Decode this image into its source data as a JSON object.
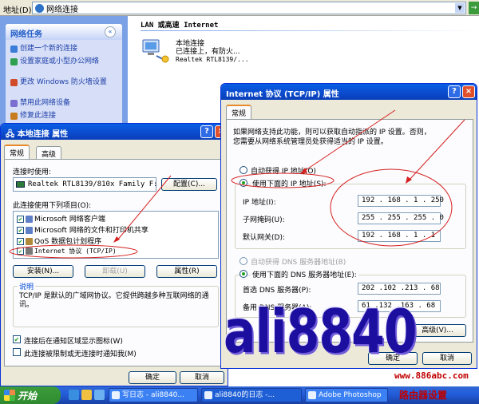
{
  "explorer": {
    "address_label": "地址(D)",
    "address_value": "网络连接",
    "go_label": "→",
    "task_pane": {
      "title": "网络任务",
      "collapse": "«",
      "items": [
        {
          "label": "创建一个新的连接",
          "color": "#3a7cd8"
        },
        {
          "label": "设置家庭或小型办公网络",
          "color": "#2fa04f"
        },
        {
          "label": "更改 Windows 防火墙设置",
          "color": "#d04b2a"
        },
        {
          "label": "禁用此网络设备",
          "color": "#7a6fd0"
        },
        {
          "label": "修复此连接",
          "color": "#c77d1f"
        }
      ]
    },
    "section_title": "LAN 或高速 Internet",
    "connection": {
      "line1": "本地连接",
      "line2": "已连接上，有防火...",
      "line3": "Realtek RTL8139/..."
    }
  },
  "local_dialog": {
    "title": "本地连接 属性",
    "help_btn": "?",
    "close_btn": "×",
    "tabs": [
      "常规",
      "高级"
    ],
    "connect_using_label": "连接时使用:",
    "adapter_name": "Realtek RTL8139/810x Family F:",
    "configure_btn": "配置(C)...",
    "items_label": "此连接使用下列项目(O):",
    "items": [
      {
        "label": "Microsoft 网络客户端",
        "checked": true
      },
      {
        "label": "Microsoft 网络的文件和打印机共享",
        "checked": true
      },
      {
        "label": "QoS 数据包计划程序",
        "checked": true
      },
      {
        "label": "Internet 协议 (TCP/IP)",
        "checked": true
      }
    ],
    "install_btn": "安装(N)...",
    "uninstall_btn": "卸载(U)",
    "properties_btn": "属性(R)",
    "description_label": "说明",
    "description": "TCP/IP 是默认的广域网协议。它提供跨越多种互联网络的通讯。",
    "show_icon_label": "连接后在通知区域显示图标(W)",
    "show_icon_checked": true,
    "notify_label": "此连接被限制或无连接时通知我(M)",
    "notify_checked": false,
    "ok_btn": "确定",
    "cancel_btn": "取消"
  },
  "tcp_dialog": {
    "title": "Internet 协议 (TCP/IP) 属性",
    "help_btn": "?",
    "close_btn": "×",
    "tab": "常规",
    "intro_line1": "如果网络支持此功能，则可以获取自动指派的 IP 设置。否则，",
    "intro_line2": "您需要从网络系统管理员处获得适当的 IP 设置。",
    "auto_ip_label": "自动获得 IP 地址(O)",
    "manual_ip_label": "使用下面的 IP 地址(S):",
    "ip_label": "IP 地址(I):",
    "ip_value": "192 . 168 .  1  . 250",
    "mask_label": "子网掩码(U):",
    "mask_value": "255 . 255 . 255 .  0",
    "gateway_label": "默认网关(D):",
    "gateway_value": "192 . 168 .  1  .  1",
    "auto_dns_label": "自动获得 DNS 服务器地址(B)",
    "manual_dns_label": "使用下面的 DNS 服务器地址(E):",
    "dns1_label": "首选 DNS 服务器(P):",
    "dns1_value": "202 .102 .213 . 68",
    "dns2_label": "备用 DNS 服务器(A):",
    "dns2_value": " 61 .132 .163 . 68",
    "advanced_btn": "高级(V)...",
    "ok_btn": "确定",
    "cancel_btn": "取消"
  },
  "overlay_text": "ali8840",
  "taskbar": {
    "start_label": "开始",
    "buttons": [
      "写日志 - ali8840...",
      "ali8840的日志 -...",
      "Adobe Photoshop"
    ]
  },
  "watermark": {
    "url": "www.886abc.com",
    "name": "路由器设置"
  }
}
